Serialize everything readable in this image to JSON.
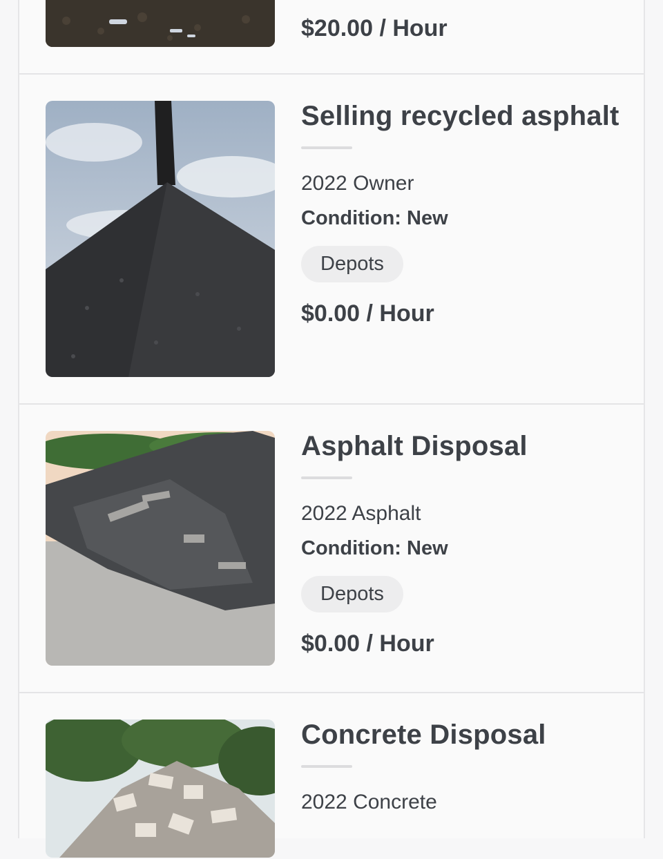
{
  "listings": [
    {
      "price": "$20.00 / Hour",
      "image": "dark-ground-photo"
    },
    {
      "title": "Selling recycled asphalt",
      "owner_line": "2022 Owner",
      "condition": "Condition: New",
      "tag": "Depots",
      "price": "$0.00 / Hour",
      "image": "asphalt-pile-conveyor-photo"
    },
    {
      "title": "Asphalt Disposal",
      "owner_line": "2022 Asphalt",
      "condition": "Condition: New",
      "tag": "Depots",
      "price": "$0.00 / Hour",
      "image": "asphalt-rubble-pile-photo"
    },
    {
      "title": "Concrete Disposal",
      "owner_line": "2022 Concrete",
      "image": "concrete-rubble-photo"
    }
  ]
}
